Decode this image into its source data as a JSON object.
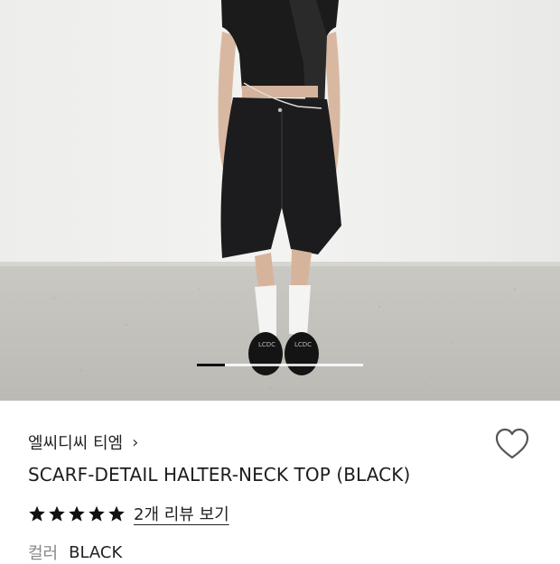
{
  "product": {
    "brand": "엘씨디씨 티엠",
    "brand_chevron": "›",
    "name": "SCARF-DETAIL HALTER-NECK TOP (BLACK)",
    "rating_stars": 5,
    "review_link": "2개 리뷰 보기",
    "option_label": "컬러",
    "option_value": "BLACK"
  },
  "gallery": {
    "image_description_icon": "photo-model-wearing-product",
    "progress_fraction": 0.17
  },
  "colors": {
    "star": "#111111",
    "heart_outline": "#555555"
  }
}
